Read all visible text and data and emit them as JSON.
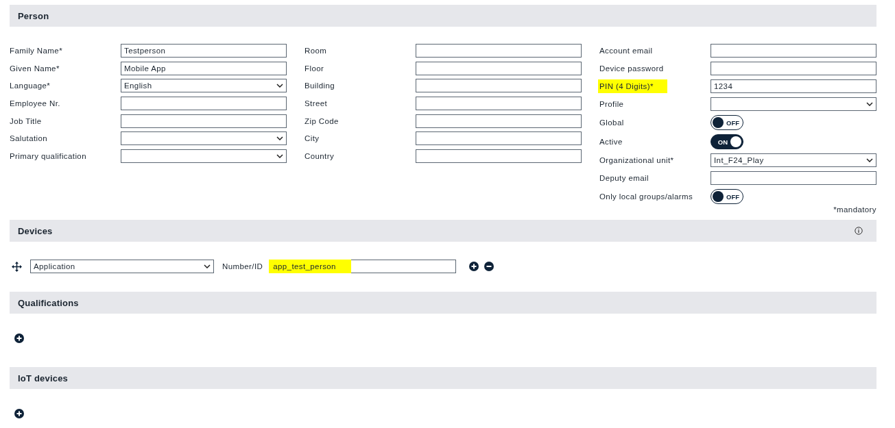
{
  "person": {
    "title": "Person",
    "columns": [
      [
        {
          "label": "Family Name*",
          "kind": "text",
          "value": "Testperson",
          "highlighted": false
        },
        {
          "label": "Given Name*",
          "kind": "text",
          "value": "Mobile App",
          "highlighted": false
        },
        {
          "label": "Language*",
          "kind": "select",
          "value": "English",
          "highlighted": false
        },
        {
          "label": "Employee Nr.",
          "kind": "text",
          "highlighted": false
        },
        {
          "label": "Job Title",
          "kind": "text",
          "highlighted": false
        },
        {
          "label": "Salutation",
          "kind": "select",
          "highlighted": false
        },
        {
          "label": "Primary qualification",
          "kind": "select",
          "highlighted": false
        }
      ],
      [
        {
          "label": "Room",
          "kind": "text",
          "highlighted": false
        },
        {
          "label": "Floor",
          "kind": "text",
          "highlighted": false
        },
        {
          "label": "Building",
          "kind": "text",
          "highlighted": false
        },
        {
          "label": "Street",
          "kind": "text",
          "highlighted": false
        },
        {
          "label": "Zip Code",
          "kind": "text",
          "highlighted": false
        },
        {
          "label": "City",
          "kind": "text",
          "highlighted": false
        },
        {
          "label": "Country",
          "kind": "text",
          "highlighted": false
        }
      ],
      [
        {
          "label": "Account email",
          "kind": "text",
          "highlighted": false
        },
        {
          "label": "Device password",
          "kind": "text",
          "highlighted": false
        },
        {
          "label": "PIN (4 Digits)*",
          "kind": "text",
          "value": "1234",
          "highlighted": true
        },
        {
          "label": "Profile",
          "kind": "select",
          "highlighted": false
        },
        {
          "label": "Global",
          "kind": "toggle",
          "on": false,
          "text": "OFF",
          "highlighted": false
        },
        {
          "label": "Active",
          "kind": "toggle",
          "on": true,
          "text": "ON",
          "highlighted": false
        },
        {
          "label": "Organizational unit*",
          "kind": "select",
          "value": "Int_F24_Play",
          "highlighted": false
        },
        {
          "label": "Deputy email",
          "kind": "text",
          "highlighted": false
        },
        {
          "label": "Only local groups/alarms",
          "kind": "toggle",
          "on": false,
          "text": "OFF",
          "highlighted": false
        }
      ]
    ],
    "note": "*mandatory"
  },
  "devices": {
    "title": "Devices",
    "rows": [
      {
        "type": "Application",
        "id_label": "Number/ID",
        "id_value": "app_test_person",
        "highlighted": true
      }
    ]
  },
  "qualifications": {
    "title": "Qualifications"
  },
  "iot_devices": {
    "title": "IoT devices"
  }
}
